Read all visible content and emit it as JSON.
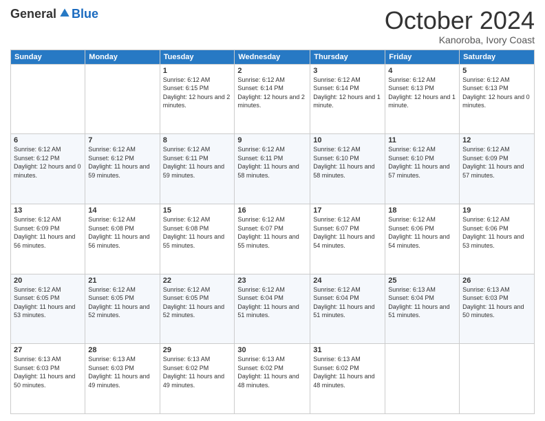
{
  "header": {
    "logo_general": "General",
    "logo_blue": "Blue",
    "month_title": "October 2024",
    "location": "Kanoroba, Ivory Coast"
  },
  "columns": [
    "Sunday",
    "Monday",
    "Tuesday",
    "Wednesday",
    "Thursday",
    "Friday",
    "Saturday"
  ],
  "weeks": [
    [
      {
        "day": "",
        "info": ""
      },
      {
        "day": "",
        "info": ""
      },
      {
        "day": "1",
        "info": "Sunrise: 6:12 AM\nSunset: 6:15 PM\nDaylight: 12 hours and 2 minutes."
      },
      {
        "day": "2",
        "info": "Sunrise: 6:12 AM\nSunset: 6:14 PM\nDaylight: 12 hours and 2 minutes."
      },
      {
        "day": "3",
        "info": "Sunrise: 6:12 AM\nSunset: 6:14 PM\nDaylight: 12 hours and 1 minute."
      },
      {
        "day": "4",
        "info": "Sunrise: 6:12 AM\nSunset: 6:13 PM\nDaylight: 12 hours and 1 minute."
      },
      {
        "day": "5",
        "info": "Sunrise: 6:12 AM\nSunset: 6:13 PM\nDaylight: 12 hours and 0 minutes."
      }
    ],
    [
      {
        "day": "6",
        "info": "Sunrise: 6:12 AM\nSunset: 6:12 PM\nDaylight: 12 hours and 0 minutes."
      },
      {
        "day": "7",
        "info": "Sunrise: 6:12 AM\nSunset: 6:12 PM\nDaylight: 11 hours and 59 minutes."
      },
      {
        "day": "8",
        "info": "Sunrise: 6:12 AM\nSunset: 6:11 PM\nDaylight: 11 hours and 59 minutes."
      },
      {
        "day": "9",
        "info": "Sunrise: 6:12 AM\nSunset: 6:11 PM\nDaylight: 11 hours and 58 minutes."
      },
      {
        "day": "10",
        "info": "Sunrise: 6:12 AM\nSunset: 6:10 PM\nDaylight: 11 hours and 58 minutes."
      },
      {
        "day": "11",
        "info": "Sunrise: 6:12 AM\nSunset: 6:10 PM\nDaylight: 11 hours and 57 minutes."
      },
      {
        "day": "12",
        "info": "Sunrise: 6:12 AM\nSunset: 6:09 PM\nDaylight: 11 hours and 57 minutes."
      }
    ],
    [
      {
        "day": "13",
        "info": "Sunrise: 6:12 AM\nSunset: 6:09 PM\nDaylight: 11 hours and 56 minutes."
      },
      {
        "day": "14",
        "info": "Sunrise: 6:12 AM\nSunset: 6:08 PM\nDaylight: 11 hours and 56 minutes."
      },
      {
        "day": "15",
        "info": "Sunrise: 6:12 AM\nSunset: 6:08 PM\nDaylight: 11 hours and 55 minutes."
      },
      {
        "day": "16",
        "info": "Sunrise: 6:12 AM\nSunset: 6:07 PM\nDaylight: 11 hours and 55 minutes."
      },
      {
        "day": "17",
        "info": "Sunrise: 6:12 AM\nSunset: 6:07 PM\nDaylight: 11 hours and 54 minutes."
      },
      {
        "day": "18",
        "info": "Sunrise: 6:12 AM\nSunset: 6:06 PM\nDaylight: 11 hours and 54 minutes."
      },
      {
        "day": "19",
        "info": "Sunrise: 6:12 AM\nSunset: 6:06 PM\nDaylight: 11 hours and 53 minutes."
      }
    ],
    [
      {
        "day": "20",
        "info": "Sunrise: 6:12 AM\nSunset: 6:05 PM\nDaylight: 11 hours and 53 minutes."
      },
      {
        "day": "21",
        "info": "Sunrise: 6:12 AM\nSunset: 6:05 PM\nDaylight: 11 hours and 52 minutes."
      },
      {
        "day": "22",
        "info": "Sunrise: 6:12 AM\nSunset: 6:05 PM\nDaylight: 11 hours and 52 minutes."
      },
      {
        "day": "23",
        "info": "Sunrise: 6:12 AM\nSunset: 6:04 PM\nDaylight: 11 hours and 51 minutes."
      },
      {
        "day": "24",
        "info": "Sunrise: 6:12 AM\nSunset: 6:04 PM\nDaylight: 11 hours and 51 minutes."
      },
      {
        "day": "25",
        "info": "Sunrise: 6:13 AM\nSunset: 6:04 PM\nDaylight: 11 hours and 51 minutes."
      },
      {
        "day": "26",
        "info": "Sunrise: 6:13 AM\nSunset: 6:03 PM\nDaylight: 11 hours and 50 minutes."
      }
    ],
    [
      {
        "day": "27",
        "info": "Sunrise: 6:13 AM\nSunset: 6:03 PM\nDaylight: 11 hours and 50 minutes."
      },
      {
        "day": "28",
        "info": "Sunrise: 6:13 AM\nSunset: 6:03 PM\nDaylight: 11 hours and 49 minutes."
      },
      {
        "day": "29",
        "info": "Sunrise: 6:13 AM\nSunset: 6:02 PM\nDaylight: 11 hours and 49 minutes."
      },
      {
        "day": "30",
        "info": "Sunrise: 6:13 AM\nSunset: 6:02 PM\nDaylight: 11 hours and 48 minutes."
      },
      {
        "day": "31",
        "info": "Sunrise: 6:13 AM\nSunset: 6:02 PM\nDaylight: 11 hours and 48 minutes."
      },
      {
        "day": "",
        "info": ""
      },
      {
        "day": "",
        "info": ""
      }
    ]
  ]
}
